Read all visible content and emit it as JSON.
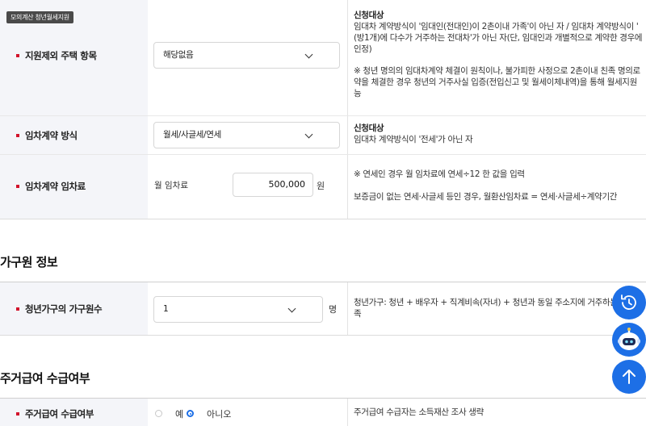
{
  "badge": "모의계산 청년월세지원",
  "rows": {
    "excluded_housing": {
      "label": "지원제외 주택 항목",
      "select_value": "해당없음",
      "desc_title": "신청대상",
      "desc_lines": [
        "임대차 계약방식이 '임대인(전대인)이 2촌이내 가족'이 아닌 자 / 임대차 계약방식이 '",
        "(방1개)에 다수가 거주하는 전대차'가 아닌 자(단, 임대인과 개별적으로 계약한 경우에",
        "인정)"
      ],
      "note_lines": [
        "※ 청년 명의의 임대차계약 체결이 원칙이나, 불가피한 사정으로 2촌이내 친족 명의로",
        "약을 체결한 경우 청년의 거주사실 입증(전입신고 및 월세이체내역)을 통해 월세지원",
        "능"
      ]
    },
    "lease_type": {
      "label": "임차계약 방식",
      "select_value": "월세/사글세/연세",
      "desc_title": "신청대상",
      "desc_line": "임대차 계약방식이 '전세'가 아닌 자"
    },
    "lease_rent": {
      "label": "임차계약 임차료",
      "field_label": "월 임차료",
      "value": "500,000",
      "unit": "원",
      "note1": "※ 연세인 경우 월 임차료에 연세÷12 한 값을 입력",
      "note2": "보증금이 없는 연세·사글세 등인 경우, 월환산임차료 = 연세·사글세÷계약기간"
    }
  },
  "household_section": {
    "title": "가구원 정보",
    "label": "청년가구의 가구원수",
    "select_value": "1",
    "unit": "명",
    "desc_lines": [
      "청년가구: 청년 + 배우자 + 직계비속(자녀) + 청년과 동일 주소지에 거주하는 형",
      "족"
    ]
  },
  "benefit_section": {
    "title": "주거급여 수급여부",
    "label": "주거급여 수급여부",
    "options": [
      "예",
      "아니오"
    ],
    "selected": "아니오",
    "desc": "주거급여 수급자는 소득재산 조사 생략"
  },
  "colors": {
    "accent_red": "#d2132c",
    "fab_blue": "#1d6fe6",
    "label_bg": "#f4f5f9"
  },
  "fab_icons": [
    "history-icon",
    "chatbot-icon",
    "arrow-up-icon"
  ]
}
